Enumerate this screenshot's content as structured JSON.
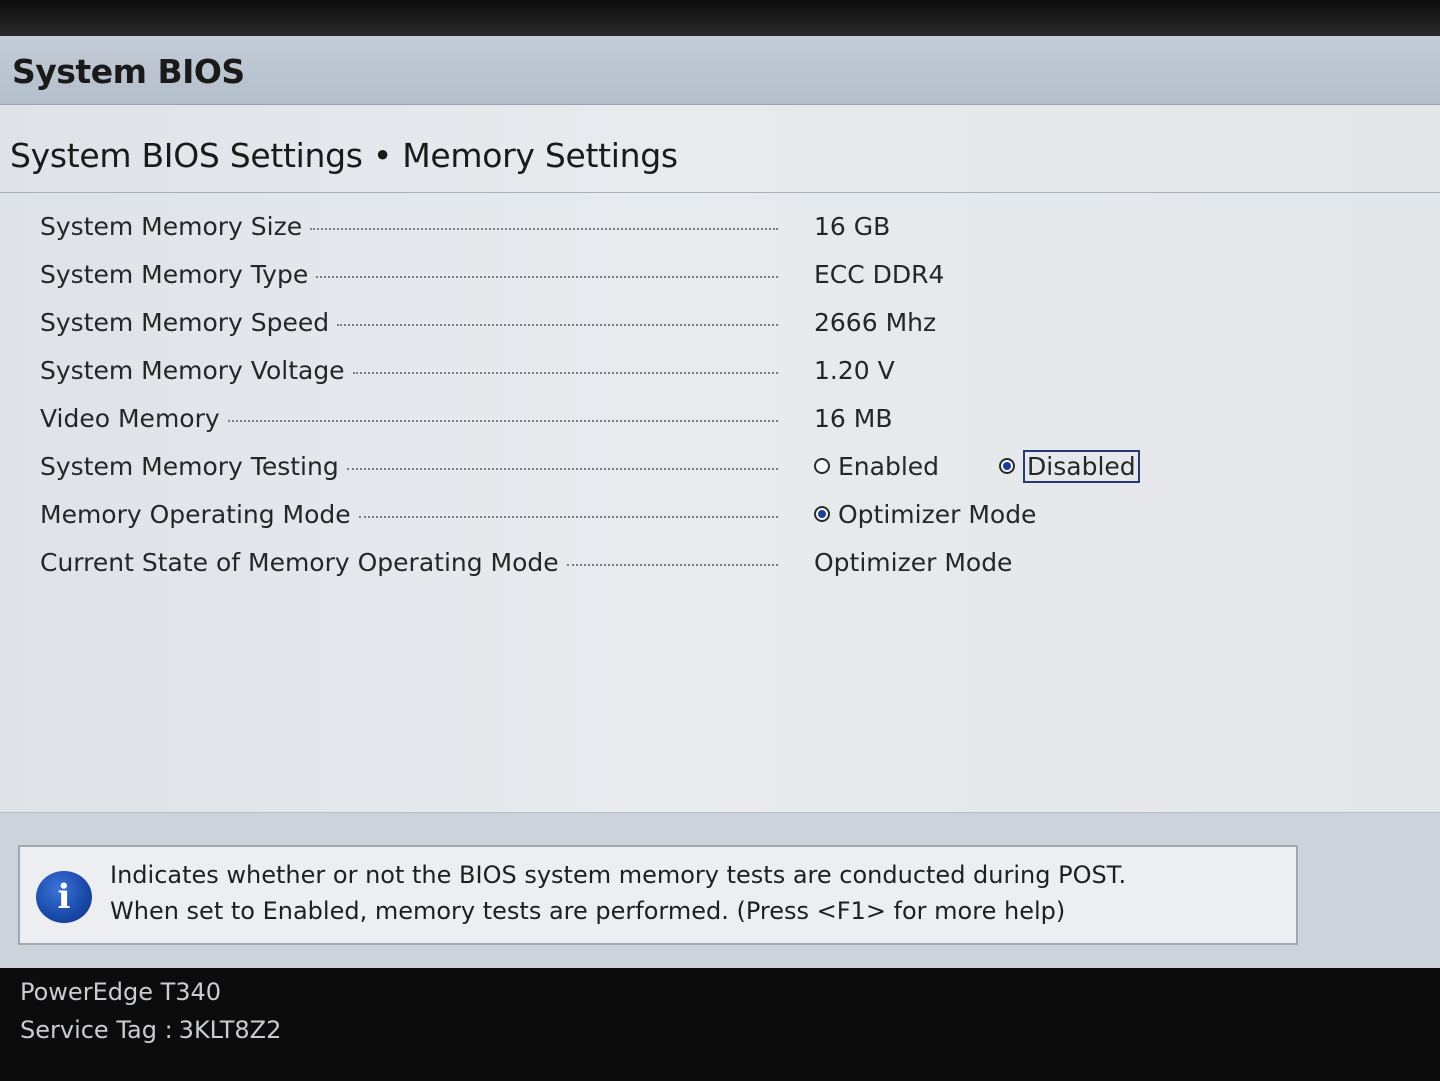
{
  "window": {
    "title": "System BIOS"
  },
  "page": {
    "heading": "System BIOS Settings • Memory Settings"
  },
  "settings": [
    {
      "label": "System Memory Size",
      "value": "16 GB"
    },
    {
      "label": "System Memory Type",
      "value": "ECC DDR4"
    },
    {
      "label": "System Memory Speed",
      "value": "2666 Mhz"
    },
    {
      "label": "System Memory Voltage",
      "value": "1.20 V"
    },
    {
      "label": "Video Memory",
      "value": "16 MB"
    },
    {
      "label": "System Memory Testing",
      "options": [
        {
          "label": "Enabled",
          "selected": false
        },
        {
          "label": "Disabled",
          "selected": true,
          "focused": true
        }
      ]
    },
    {
      "label": "Memory Operating Mode",
      "options": [
        {
          "label": "Optimizer Mode",
          "selected": true
        }
      ]
    },
    {
      "label": "Current State of Memory Operating Mode",
      "value": "Optimizer Mode"
    }
  ],
  "help": {
    "icon": "info-icon",
    "line1": "Indicates whether or not the BIOS system memory tests are conducted during POST.",
    "line2": "When set to Enabled, memory tests are performed. (Press <F1> for more help)"
  },
  "footer": {
    "model": "PowerEdge T340",
    "service_tag_label": "Service Tag :",
    "service_tag_value": "3KLT8Z2"
  },
  "colors": {
    "title_bar": "#b4bfcc",
    "background": "#e5e8eb",
    "radio_selected": "#1b3f95",
    "footer": "#0c0c0c"
  }
}
